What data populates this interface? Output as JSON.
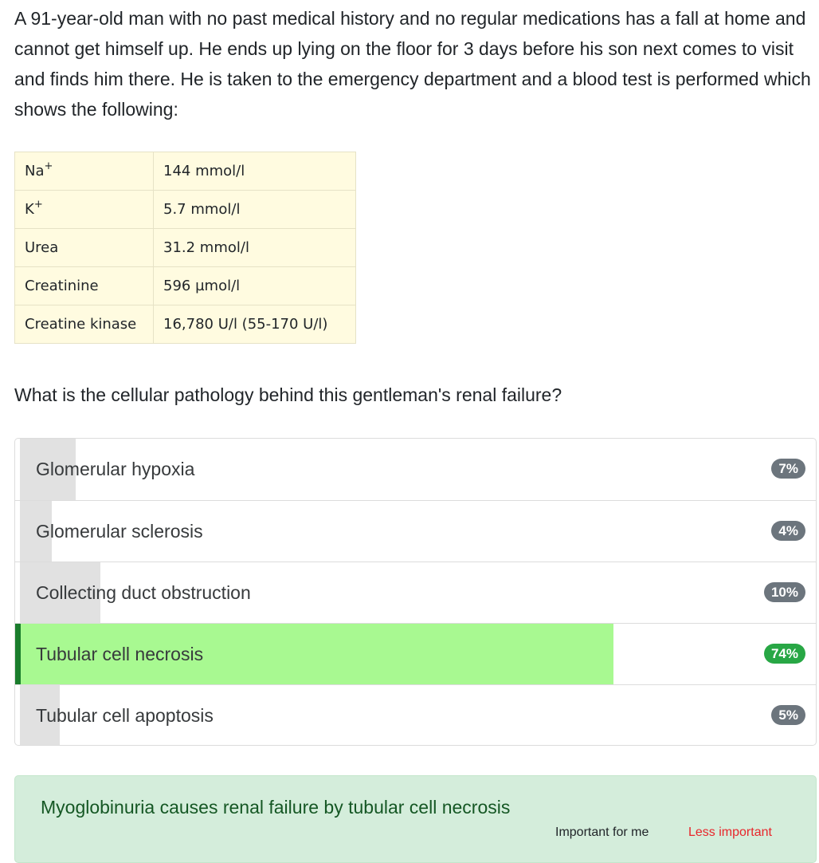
{
  "question": {
    "stem": "A 91-year-old man with no past medical history and no regular medications has a fall at home and cannot get himself up. He ends up lying on the floor for 3 days before his son next comes to visit and finds him there. He is taken to the emergency department and a blood test is performed which shows the following:",
    "prompt": "What is the cellular pathology behind this gentleman's renal failure?"
  },
  "labs": [
    {
      "name": "Na",
      "sup": "+",
      "value": "144 mmol/l"
    },
    {
      "name": "K",
      "sup": "+",
      "value": "5.7 mmol/l"
    },
    {
      "name": "Urea",
      "sup": "",
      "value": "31.2 mmol/l"
    },
    {
      "name": "Creatinine",
      "sup": "",
      "value": "596 µmol/l"
    },
    {
      "name": "Creatine kinase",
      "sup": "",
      "value": "16,780 U/l (55-170 U/l)"
    }
  ],
  "options": [
    {
      "label": "Glomerular hypoxia",
      "percent_label": "7%",
      "percent": 7,
      "correct": false
    },
    {
      "label": "Glomerular sclerosis",
      "percent_label": "4%",
      "percent": 4,
      "correct": false
    },
    {
      "label": "Collecting duct obstruction",
      "percent_label": "10%",
      "percent": 10,
      "correct": false
    },
    {
      "label": "Tubular cell necrosis",
      "percent_label": "74%",
      "percent": 74,
      "correct": true
    },
    {
      "label": "Tubular cell apoptosis",
      "percent_label": "5%",
      "percent": 5,
      "correct": false
    }
  ],
  "explanation": {
    "text": "Myoglobinuria causes renal failure by tubular cell necrosis",
    "important_label": "Important for me",
    "less_important_label": "Less important"
  },
  "colors": {
    "correct_fill": "#a8f991",
    "correct_accent": "#1a7d2c",
    "incorrect_fill": "#e1e1e1",
    "badge_default": "#6c757d",
    "badge_correct": "#28a745",
    "lab_cell_bg": "#fffbe0",
    "explanation_bg": "#d4eddb",
    "less_important": "#e8262b"
  }
}
